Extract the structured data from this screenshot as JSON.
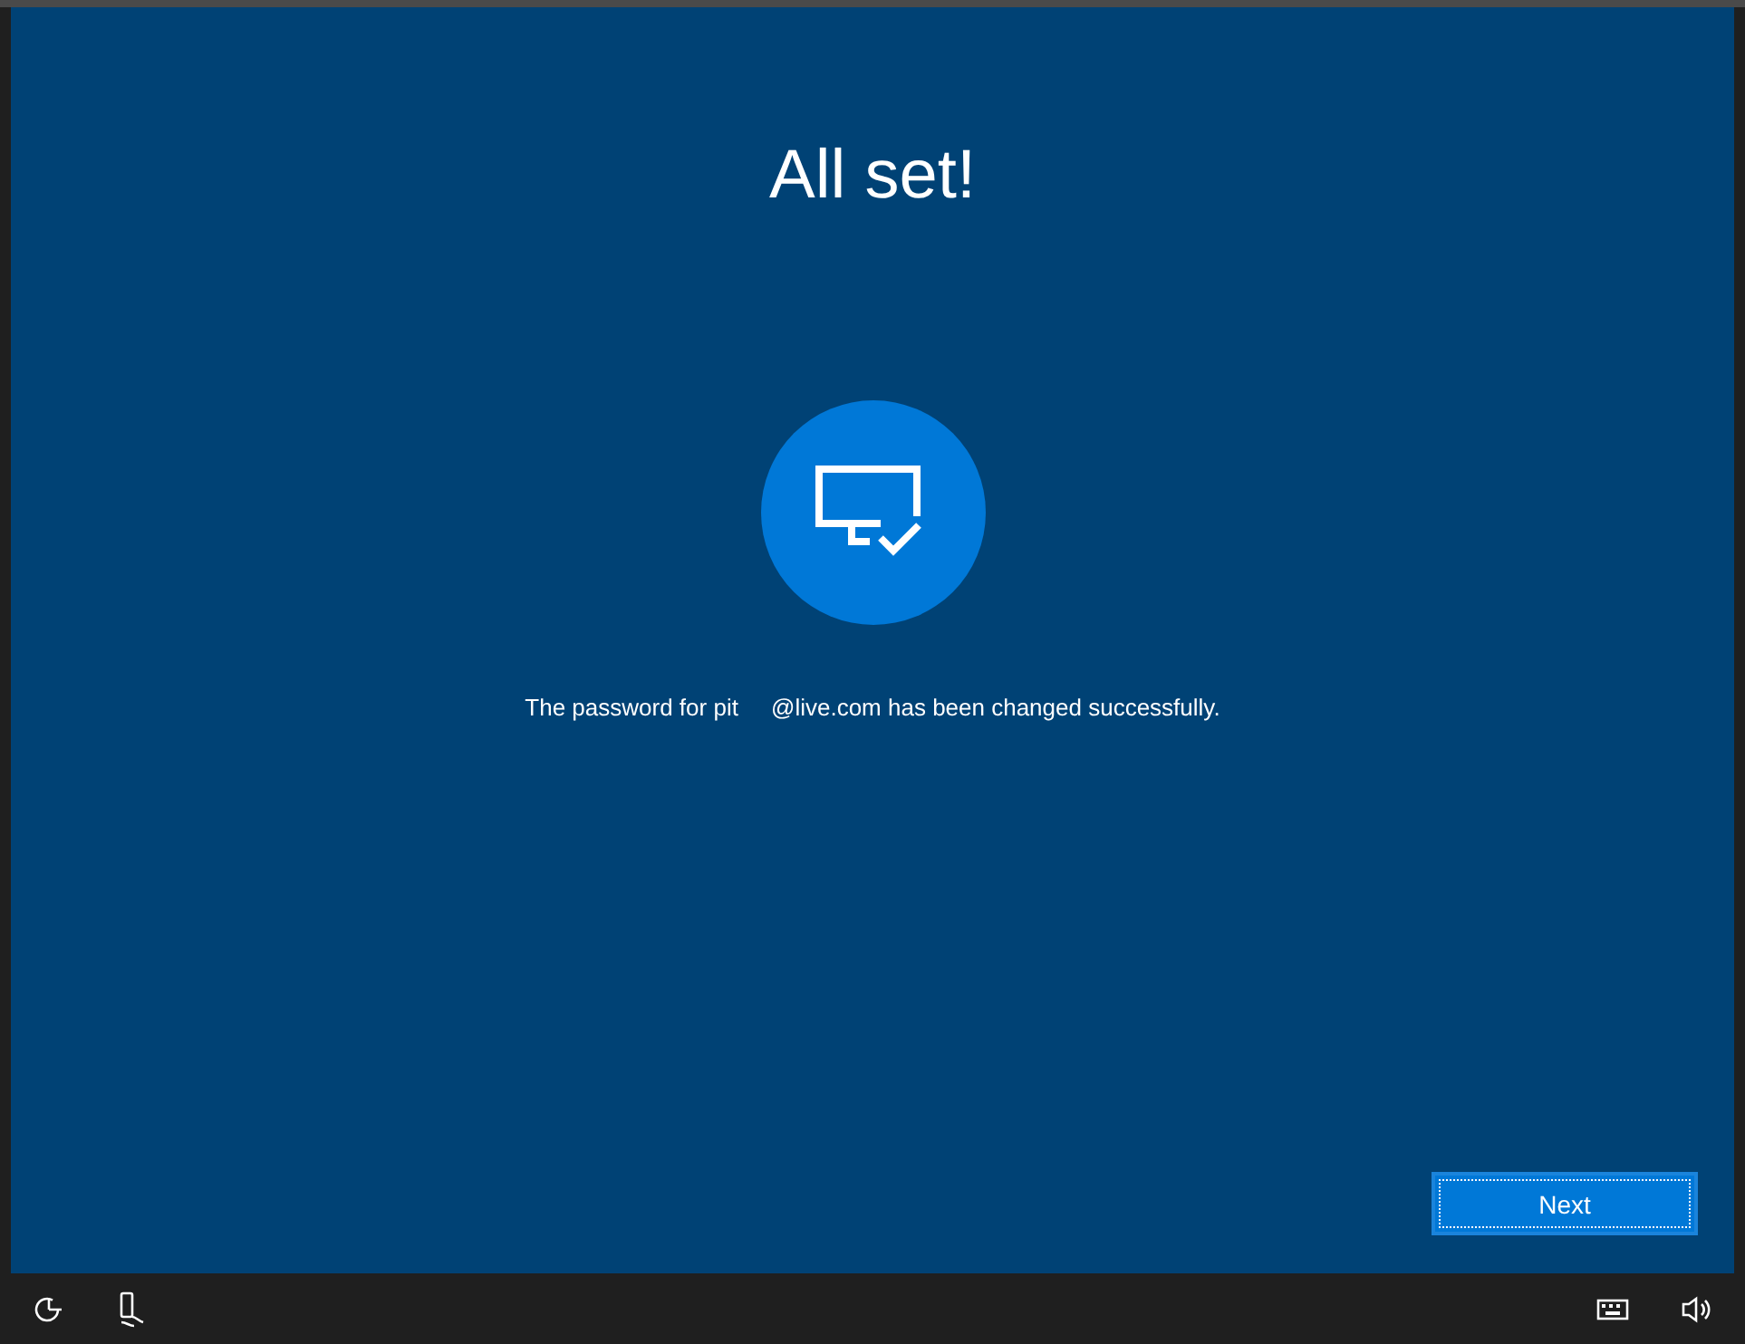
{
  "title": "All set!",
  "message": "The password for pit     @live.com has been changed successfully.",
  "buttons": [
    {
      "label": "Next",
      "focused": true
    }
  ],
  "taskbar": {
    "left": [
      {
        "kind": "ease"
      },
      {
        "kind": "narrator"
      }
    ],
    "right": [
      {
        "kind": "keyboard"
      },
      {
        "kind": "volume"
      }
    ]
  }
}
